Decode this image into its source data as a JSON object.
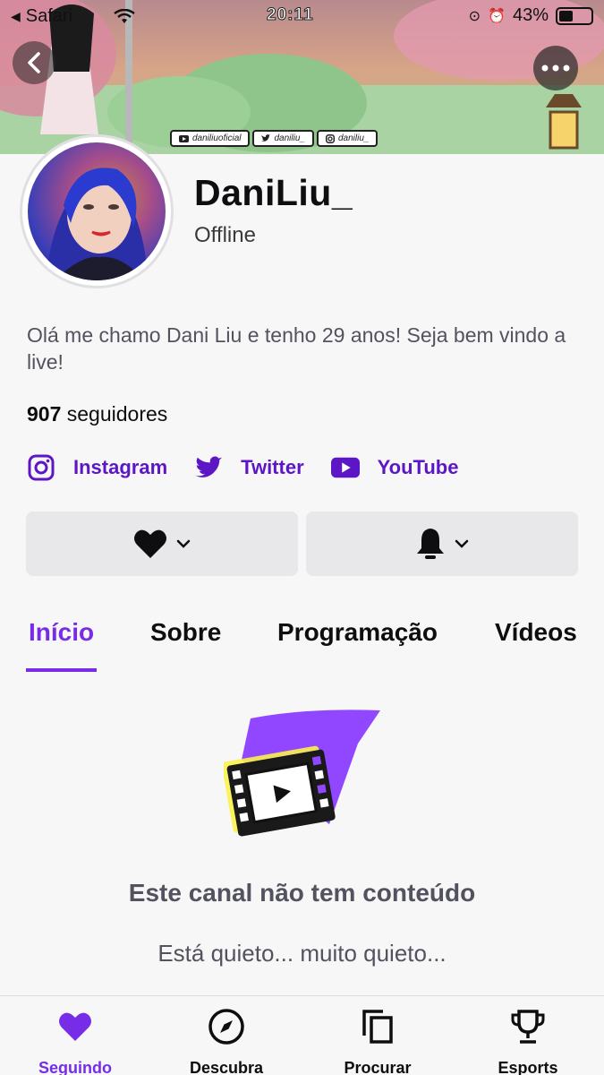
{
  "status_bar": {
    "back_app": "Safari",
    "time": "20:11",
    "battery": "43%",
    "battery_level": 0.43
  },
  "banner": {
    "social_tags": [
      {
        "icon": "youtube-icon",
        "text": "daniliuoficial"
      },
      {
        "icon": "twitter-icon",
        "text": "daniliu_"
      },
      {
        "icon": "instagram-icon",
        "text": "daniliu_"
      }
    ]
  },
  "channel": {
    "name": "DaniLiu_",
    "status": "Offline",
    "bio": "Olá me chamo Dani Liu e tenho 29 anos! Seja bem vindo a live!",
    "followers_count": "907",
    "followers_label": "seguidores"
  },
  "links": [
    {
      "label": "Instagram",
      "icon": "instagram-icon"
    },
    {
      "label": "Twitter",
      "icon": "twitter-icon"
    },
    {
      "label": "YouTube",
      "icon": "youtube-icon"
    }
  ],
  "tabs": [
    {
      "label": "Início",
      "active": true
    },
    {
      "label": "Sobre",
      "active": false
    },
    {
      "label": "Programação",
      "active": false
    },
    {
      "label": "Vídeos",
      "active": false
    }
  ],
  "empty_state": {
    "title": "Este canal não tem conteúdo",
    "subtitle": "Está quieto... muito quieto..."
  },
  "bottom_nav": [
    {
      "label": "Seguindo",
      "icon": "heart-icon",
      "active": true
    },
    {
      "label": "Descubra",
      "icon": "compass-icon",
      "active": false
    },
    {
      "label": "Procurar",
      "icon": "browse-icon",
      "active": false
    },
    {
      "label": "Esports",
      "icon": "trophy-icon",
      "active": false
    }
  ],
  "colors": {
    "accent": "#772ce8",
    "link": "#5c16c5",
    "button_bg": "#e8e8ea",
    "background": "#f7f7f8"
  }
}
